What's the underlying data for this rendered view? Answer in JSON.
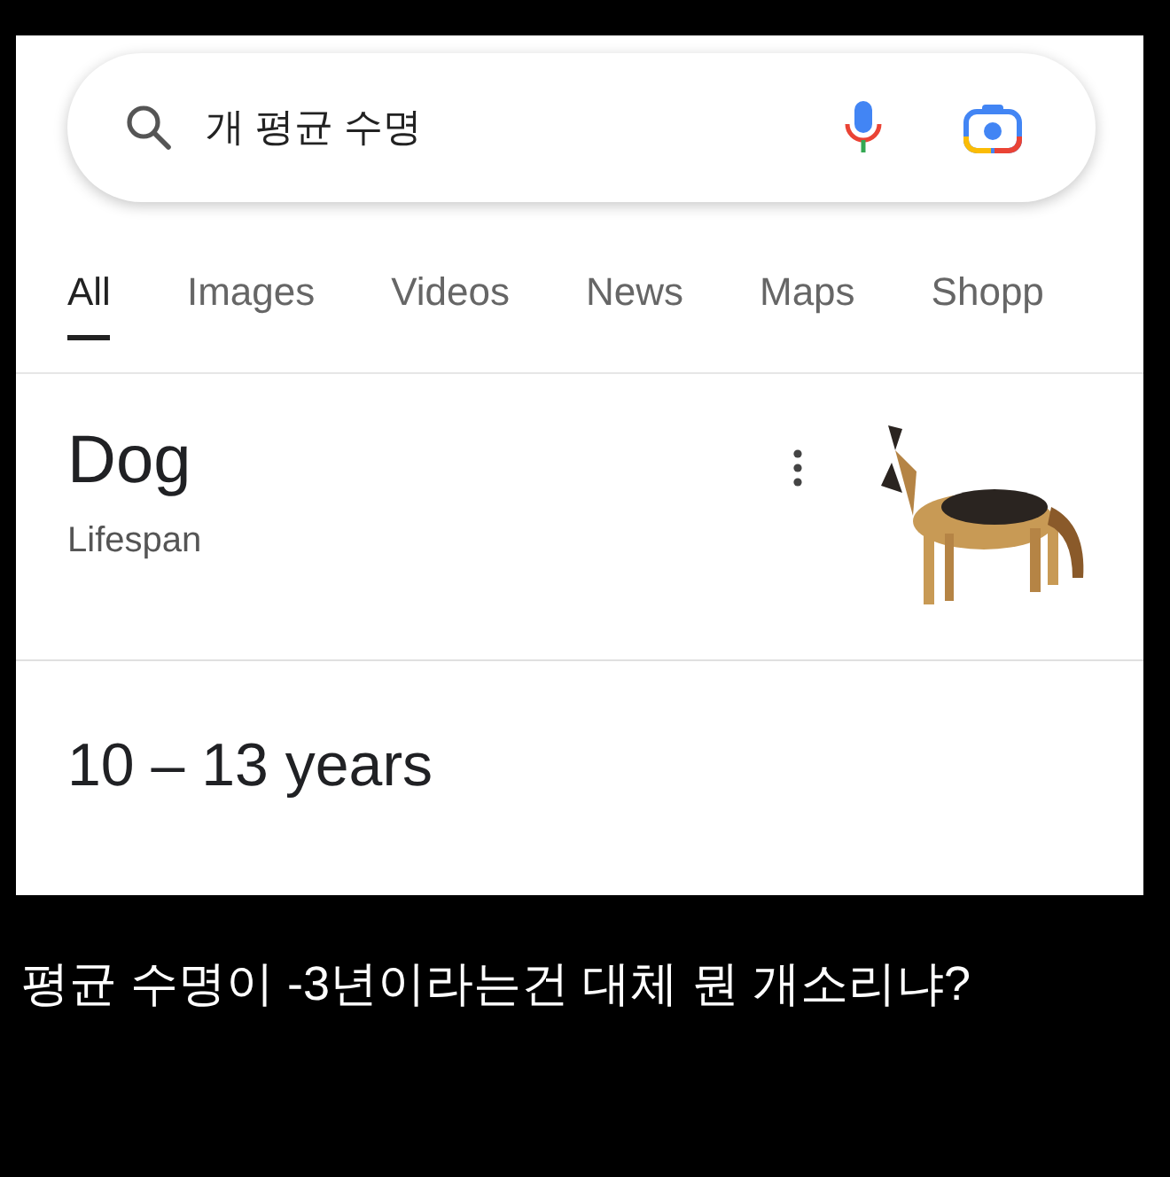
{
  "search": {
    "value": "개 평균 수명"
  },
  "tabs": [
    {
      "label": "All",
      "selected": true
    },
    {
      "label": "Images",
      "selected": false
    },
    {
      "label": "Videos",
      "selected": false
    },
    {
      "label": "News",
      "selected": false
    },
    {
      "label": "Maps",
      "selected": false
    },
    {
      "label": "Shopp",
      "selected": false
    }
  ],
  "result": {
    "title": "Dog",
    "subtitle": "Lifespan",
    "answer": "10 – 13 years"
  },
  "caption": "평균 수명이 -3년이라는건 대체 뭔 개소리냐?"
}
